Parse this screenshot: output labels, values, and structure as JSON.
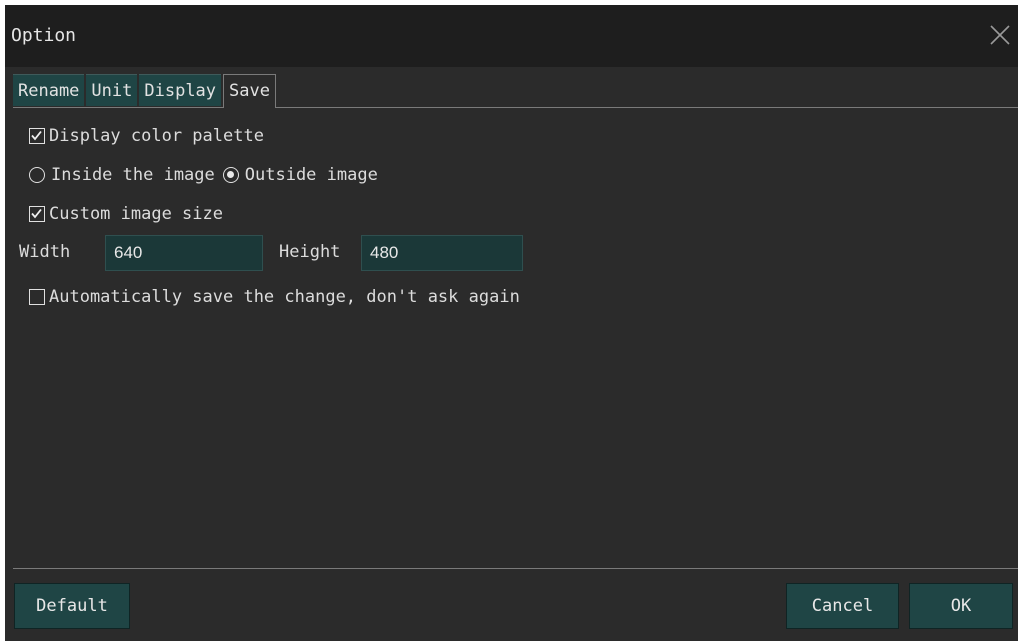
{
  "window": {
    "title": "Option",
    "close_icon": "close-icon"
  },
  "tabs": [
    {
      "label": "Rename",
      "active": false
    },
    {
      "label": "Unit",
      "active": false
    },
    {
      "label": "Display",
      "active": false
    },
    {
      "label": "Save",
      "active": true
    }
  ],
  "save": {
    "display_palette": {
      "label": "Display color palette",
      "checked": true
    },
    "palette_position": {
      "options": [
        "Inside the image",
        "Outside image"
      ],
      "selected": "Outside image"
    },
    "custom_size": {
      "label": "Custom image size",
      "checked": true
    },
    "width": {
      "label": "Width",
      "value": "640"
    },
    "height": {
      "label": "Height",
      "value": "480"
    },
    "auto_save": {
      "label": "Automatically save the change, don't ask again",
      "checked": false
    }
  },
  "buttons": {
    "default": "Default",
    "cancel": "Cancel",
    "ok": "OK"
  },
  "colors": {
    "background": "#2b2b2b",
    "titlebar": "#1e1e1e",
    "accent": "#1f4545",
    "input": "#1b3838",
    "text": "#dcdcdc"
  }
}
